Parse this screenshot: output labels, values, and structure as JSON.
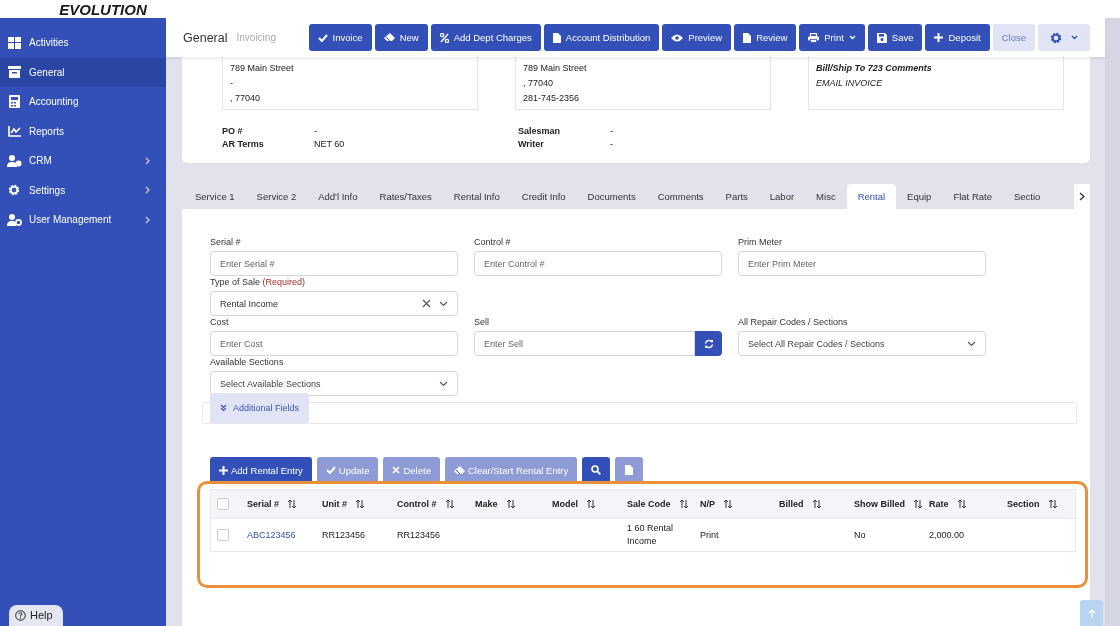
{
  "logo": {
    "text": "EVOLUTION"
  },
  "sidebar": {
    "items": [
      {
        "label": "Activities",
        "selected": false,
        "expandable": false
      },
      {
        "label": "General",
        "selected": true,
        "expandable": false
      },
      {
        "label": "Accounting",
        "selected": false,
        "expandable": false
      },
      {
        "label": "Reports",
        "selected": false,
        "expandable": false
      },
      {
        "label": "CRM",
        "selected": false,
        "expandable": true
      },
      {
        "label": "Settings",
        "selected": false,
        "expandable": true
      },
      {
        "label": "User Management",
        "selected": false,
        "expandable": true
      }
    ],
    "help": "Help"
  },
  "header": {
    "title": "General",
    "subtitle": "Invoicing",
    "buttons": [
      {
        "label": "Invoice",
        "kind": "primary",
        "dropdown": false
      },
      {
        "label": "New",
        "kind": "primary",
        "dropdown": false
      },
      {
        "label": "Add Dept Charges",
        "kind": "primary",
        "dropdown": false
      },
      {
        "label": "Account Distribution",
        "kind": "primary",
        "dropdown": false
      },
      {
        "label": "Preview",
        "kind": "primary",
        "dropdown": false
      },
      {
        "label": "Review",
        "kind": "primary",
        "dropdown": false
      },
      {
        "label": "Print",
        "kind": "primary",
        "dropdown": true
      },
      {
        "label": "Save",
        "kind": "primary",
        "dropdown": false
      },
      {
        "label": "Deposit",
        "kind": "primary",
        "dropdown": false
      },
      {
        "label": "Close",
        "kind": "light",
        "dropdown": false
      },
      {
        "kind": "settings",
        "dropdown": true
      }
    ]
  },
  "addresses": [
    {
      "kind": "address",
      "lines": [
        "789 Main Street",
        "-",
        ", 77040"
      ]
    },
    {
      "kind": "address",
      "lines": [
        "789 Main Street",
        ", 77040",
        "281-745-2356"
      ]
    },
    {
      "kind": "comments",
      "title": "Bill/Ship To 723 Comments",
      "lines": [
        "EMAIL INVOICE"
      ]
    }
  ],
  "details": [
    [
      {
        "label": "PO #",
        "value": "-"
      },
      {
        "label": "AR Terms",
        "value": "NET 60"
      }
    ],
    [
      {
        "label": "Salesman",
        "value": "-"
      },
      {
        "label": "Writer",
        "value": "-"
      }
    ]
  ],
  "tabs": [
    {
      "label": "Service 1",
      "selected": false
    },
    {
      "label": "Service 2",
      "selected": false
    },
    {
      "label": "Add'l Info",
      "selected": false
    },
    {
      "label": "Rates/Taxes",
      "selected": false
    },
    {
      "label": "Rental Info",
      "selected": false
    },
    {
      "label": "Credit Info",
      "selected": false
    },
    {
      "label": "Documents",
      "selected": false
    },
    {
      "label": "Comments",
      "selected": false
    },
    {
      "label": "Parts",
      "selected": false
    },
    {
      "label": "Labor",
      "selected": false
    },
    {
      "label": "Misc",
      "selected": false
    },
    {
      "label": "Rental",
      "selected": true
    },
    {
      "label": "Equip",
      "selected": false
    },
    {
      "label": "Flat Rate",
      "selected": false
    },
    {
      "label": "Sectio",
      "selected": false
    }
  ],
  "form_rows": [
    [
      {
        "label": "Serial #",
        "kind": "text",
        "placeholder": "Enter Serial #"
      },
      {
        "label": "Control #",
        "kind": "text",
        "placeholder": "Enter Control #"
      },
      {
        "label": "Prim Meter",
        "kind": "text",
        "placeholder": "Enter Prim Meter"
      }
    ],
    [
      {
        "label": "Type of Sale",
        "note": "(Required)",
        "kind": "select",
        "value": "Rental Income",
        "clearable": true
      }
    ],
    [
      {
        "label": "Cost",
        "kind": "text",
        "placeholder": "Enter Cost"
      },
      {
        "label": "Sell",
        "kind": "refresh",
        "placeholder": "Enter Sell"
      },
      {
        "label": "All Repair Codes / Sections",
        "kind": "select",
        "placeholder": "Select All Repair Codes / Sections",
        "clearable": false
      }
    ],
    [
      {
        "label": "Available Sections",
        "kind": "select",
        "placeholder": "Select Available Sections",
        "clearable": false
      }
    ]
  ],
  "additional_fields": {
    "label": "Additional Fields",
    "expanded": false
  },
  "actions": [
    {
      "label": "Add Rental Entry",
      "disabled": false
    },
    {
      "label": "Update",
      "disabled": true
    },
    {
      "label": "Delete",
      "disabled": true
    },
    {
      "label": "Clear/Start Rental Entry",
      "disabled": true
    },
    {
      "kind": "search",
      "disabled": false
    },
    {
      "kind": "file",
      "disabled": true
    }
  ],
  "table": {
    "highlighted": true,
    "all_checked": false,
    "columns": [
      {
        "label": "Serial #"
      },
      {
        "label": "Unit #"
      },
      {
        "label": "Control #"
      },
      {
        "label": "Make"
      },
      {
        "label": "Model"
      },
      {
        "label": "Sale Code"
      },
      {
        "label": "N/P"
      },
      {
        "label": "Billed"
      },
      {
        "label": "Show Billed"
      },
      {
        "label": "Rate"
      },
      {
        "label": "Section"
      }
    ],
    "rows": [
      {
        "checked": false,
        "cells": [
          {
            "text": "ABC123456",
            "kind": "link"
          },
          "RR123456",
          "RR123456",
          null,
          null,
          "1 60 Rental Income",
          "Print",
          null,
          "No",
          "2,000.00",
          null
        ]
      }
    ]
  }
}
